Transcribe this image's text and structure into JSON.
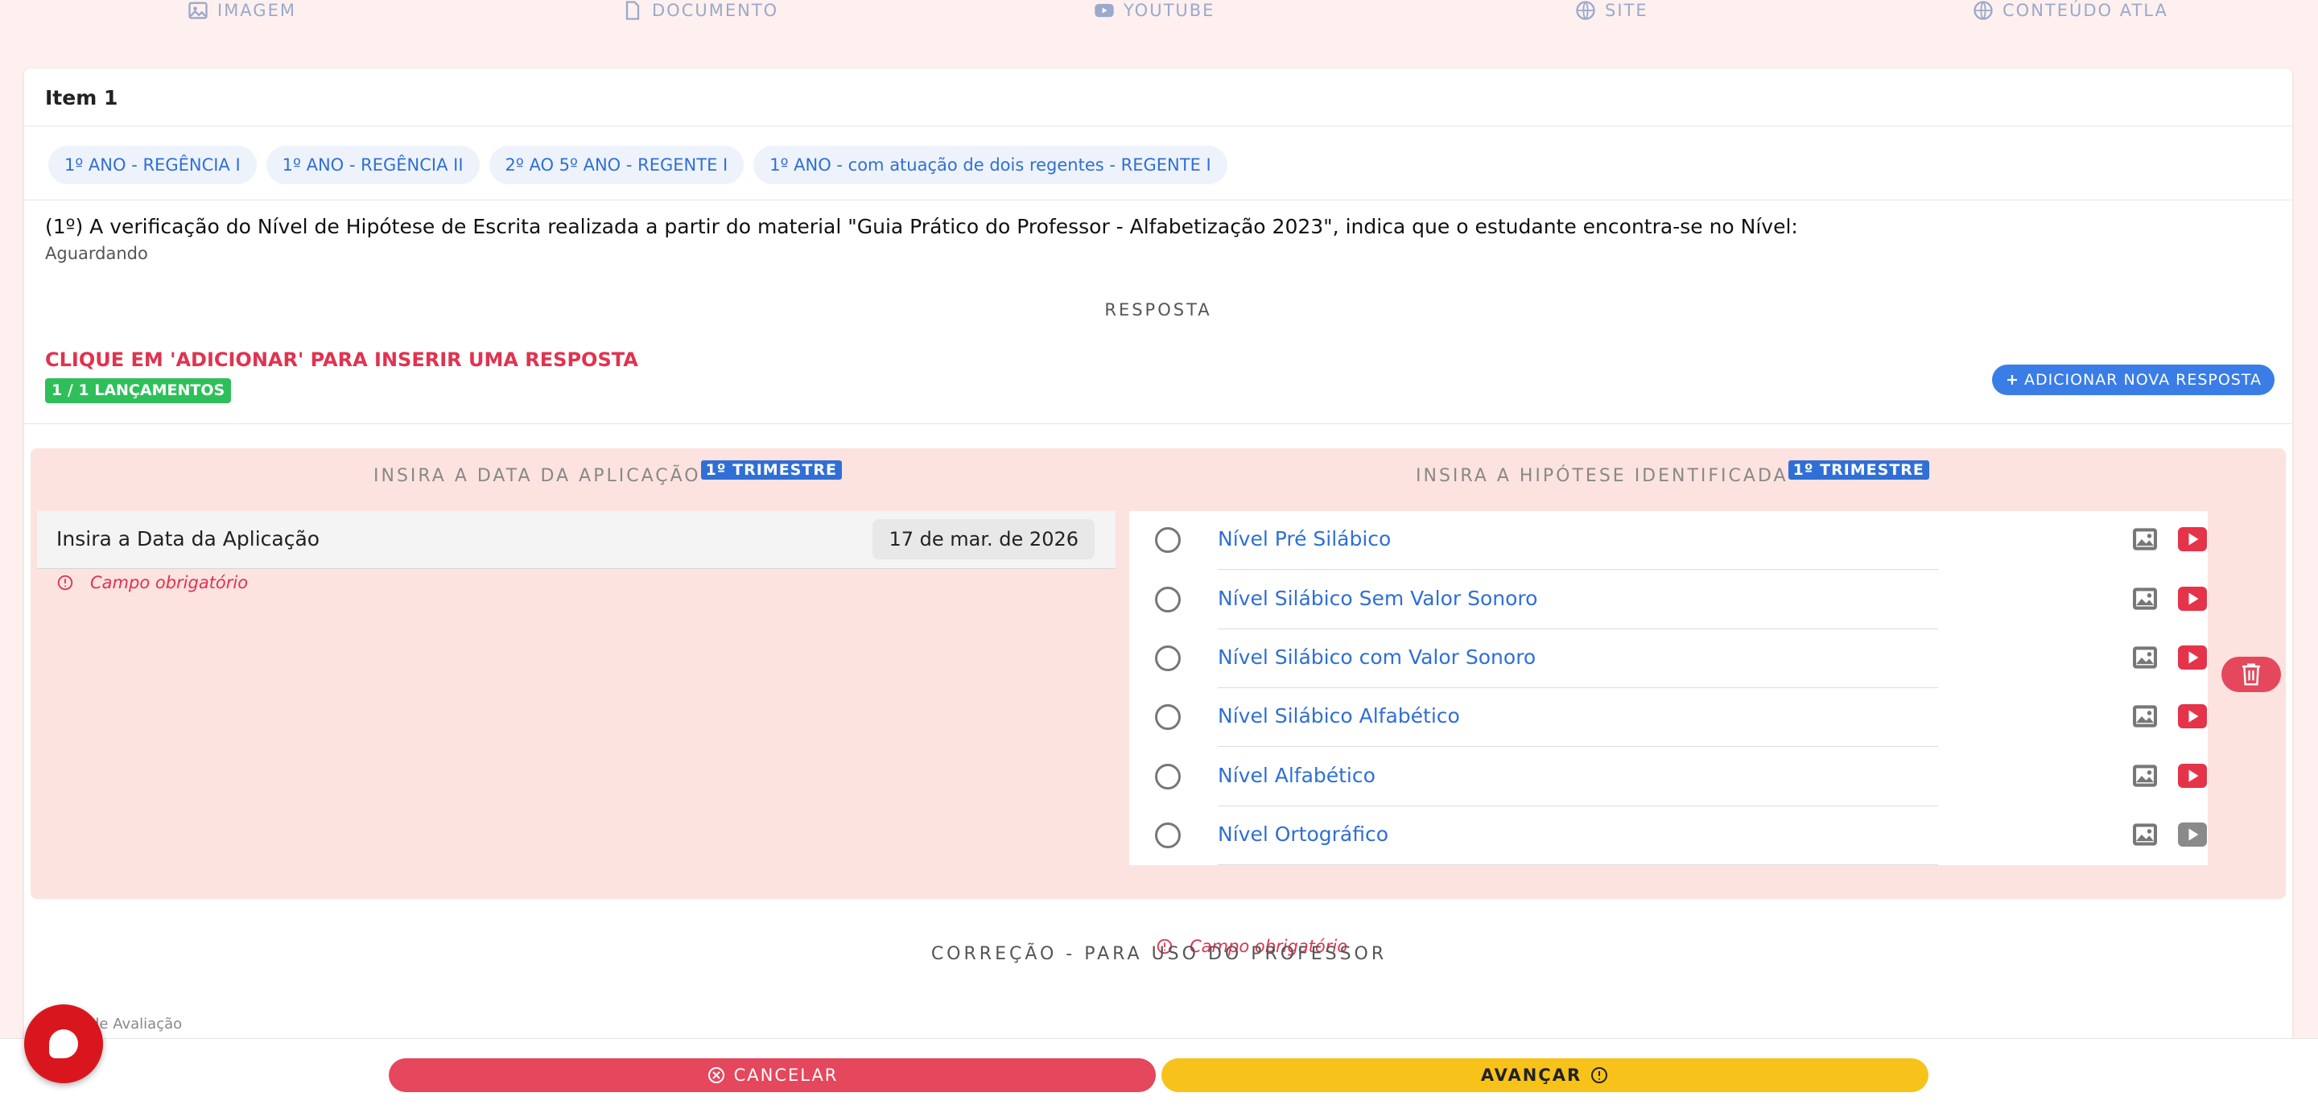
{
  "top_tabs": [
    {
      "label": "IMAGEM",
      "icon": "image-icon"
    },
    {
      "label": "DOCUMENTO",
      "icon": "document-icon"
    },
    {
      "label": "YOUTUBE",
      "icon": "youtube-icon"
    },
    {
      "label": "SITE",
      "icon": "globe-icon"
    },
    {
      "label": "CONTEÚDO ATLA",
      "icon": "globe-icon"
    }
  ],
  "item": {
    "title": "Item 1",
    "chips": [
      "1º ANO - REGÊNCIA I",
      "1º ANO - REGÊNCIA II",
      "2º AO 5º ANO - REGENTE I",
      "1º ANO - com atuação de dois regentes - REGENTE I"
    ],
    "question": "(1º) A verificação do Nível de Hipótese de Escrita realizada a partir do material \"Guia Prático do Professor - Alfabetização 2023\", indica que o estudante encontra-se no Nível:",
    "status": "Aguardando",
    "resposta_heading": "RESPOSTA",
    "alert": "CLIQUE EM 'ADICIONAR' PARA INSERIR UMA RESPOSTA",
    "launches": "1 / 1 LANÇAMENTOS",
    "add_button": "ADICIONAR NOVA RESPOSTA"
  },
  "answer": {
    "date_heading": "INSIRA A DATA DA APLICAÇÃO",
    "hypothesis_heading": "INSIRA A HIPÓTESE IDENTIFICADA",
    "trimester_badge": "1º TRIMESTRE",
    "date_label": "Insira a Data da Aplicação",
    "date_value": "17 de mar. de 2026",
    "required_text": "Campo obrigatório",
    "options": [
      {
        "label": "Nível Pré Silábico",
        "video_active": true
      },
      {
        "label": "Nível Silábico Sem Valor Sonoro",
        "video_active": true
      },
      {
        "label": "Nível Silábico com Valor Sonoro",
        "video_active": true
      },
      {
        "label": "Nível Silábico Alfabético",
        "video_active": true
      },
      {
        "label": "Nível Alfabético",
        "video_active": true
      },
      {
        "label": "Nível Ortográfico",
        "video_active": false
      }
    ]
  },
  "correction_heading": "CORREÇÃO - PARA USO DO PROFESSOR",
  "aval_label": "de Avaliação",
  "footer": {
    "cancel": "CANCELAR",
    "next": "AVANÇAR"
  },
  "colors": {
    "accent_blue": "#2f6fd6",
    "danger": "#e5475c",
    "warning": "#f7c21a",
    "success": "#2fbf5a",
    "youtube_red": "#e5334a",
    "youtube_gray": "#8a8a8a"
  }
}
